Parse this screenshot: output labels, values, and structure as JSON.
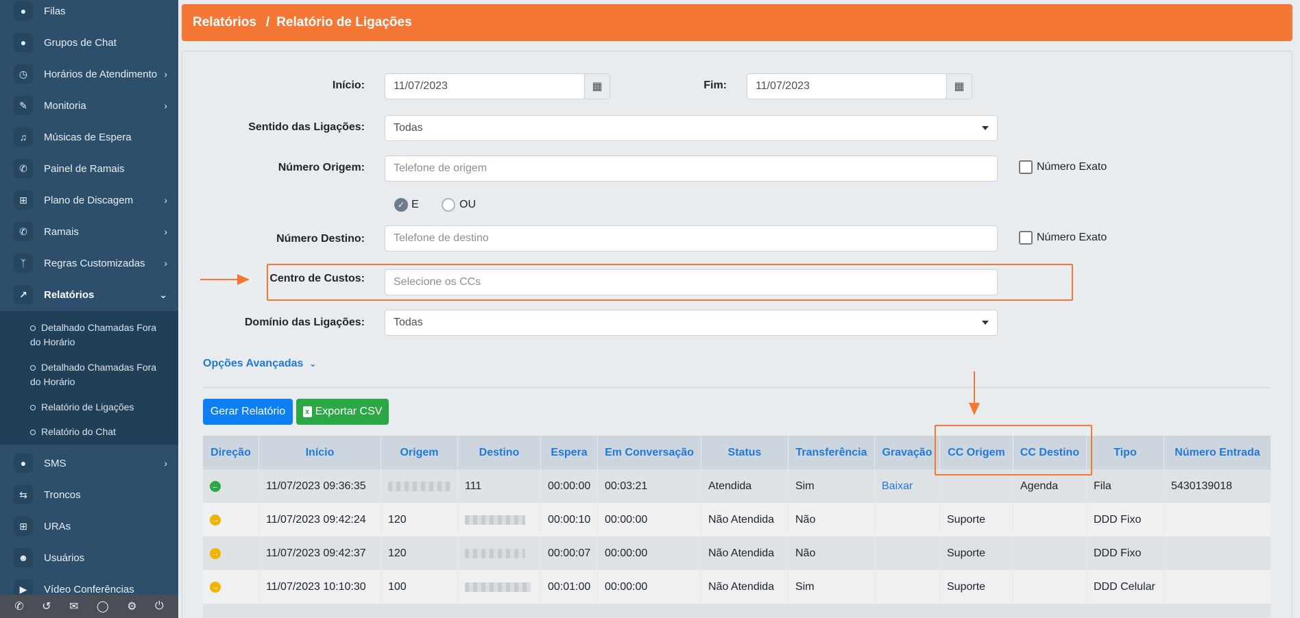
{
  "sidebar": {
    "items": [
      {
        "label": "Filas",
        "icon": "users-icon",
        "chevron": false
      },
      {
        "label": "Grupos de Chat",
        "icon": "users-icon",
        "chevron": false
      },
      {
        "label": "Horários de Atendimento",
        "icon": "clock-icon",
        "chevron": true
      },
      {
        "label": "Monitoria",
        "icon": "edit-icon",
        "chevron": true
      },
      {
        "label": "Músicas de Espera",
        "icon": "music-icon",
        "chevron": false
      },
      {
        "label": "Painel de Ramais",
        "icon": "phone-icon",
        "chevron": false
      },
      {
        "label": "Plano de Discagem",
        "icon": "sitemap-icon",
        "chevron": true
      },
      {
        "label": "Ramais",
        "icon": "phone-icon",
        "chevron": true
      },
      {
        "label": "Regras Customizadas",
        "icon": "branch-icon",
        "chevron": true
      },
      {
        "label": "Relatórios",
        "icon": "chart-icon",
        "chevron": "down"
      },
      {
        "label": "SMS",
        "icon": "comment-icon",
        "chevron": true
      },
      {
        "label": "Troncos",
        "icon": "exchange-icon",
        "chevron": false
      },
      {
        "label": "URAs",
        "icon": "sitemap-icon",
        "chevron": false
      },
      {
        "label": "Usuários",
        "icon": "user-icon",
        "chevron": false
      },
      {
        "label": "Vídeo Conferências",
        "icon": "video-icon",
        "chevron": false
      }
    ],
    "submenu": [
      "Detalhado Chamadas Fora do Horário",
      "Detalhado Chamadas Fora do Horário",
      "Relatório de Ligações",
      "Relatório do Chat"
    ]
  },
  "header": {
    "section": "Relatórios",
    "separator": "/",
    "page": "Relatório de Ligações"
  },
  "form": {
    "inicio_label": "Início:",
    "inicio_value": "11/07/2023",
    "fim_label": "Fim:",
    "fim_value": "11/07/2023",
    "sentido_label": "Sentido das Ligações:",
    "sentido_value": "Todas",
    "origem_label": "Número Origem:",
    "origem_placeholder": "Telefone de origem",
    "exato_label": "Número Exato",
    "radio_e": "E",
    "radio_ou": "OU",
    "destino_label": "Número Destino:",
    "destino_placeholder": "Telefone de destino",
    "cc_label": "Centro de Custos:",
    "cc_placeholder": "Selecione os CCs",
    "dominio_label": "Domínio das Ligações:",
    "dominio_value": "Todas",
    "advanced_label": "Opções Avançadas",
    "gerar_label": "Gerar Relatório",
    "export_label": "Exportar CSV"
  },
  "table": {
    "headers": [
      "Direção",
      "Início",
      "Origem",
      "Destino",
      "Espera",
      "Em Conversação",
      "Status",
      "Transferência",
      "Gravação",
      "CC Origem",
      "CC Destino",
      "Tipo",
      "Número Entrada"
    ],
    "rows": [
      {
        "direction": "incoming",
        "inicio": "11/07/2023 09:36:35",
        "origem": "",
        "destino": "111",
        "espera": "00:00:00",
        "conversa": "00:03:21",
        "status": "Atendida",
        "transf": "Sim",
        "gravacao": "Baixar",
        "cc_origem": "",
        "cc_destino": "Agenda",
        "tipo": "Fila",
        "entrada": "5430139018"
      },
      {
        "direction": "outgoing",
        "inicio": "11/07/2023 09:42:24",
        "origem": "120",
        "destino": "",
        "espera": "00:00:10",
        "conversa": "00:00:00",
        "status": "Não Atendida",
        "transf": "Não",
        "gravacao": "",
        "cc_origem": "Suporte",
        "cc_destino": "",
        "tipo": "DDD Fixo",
        "entrada": ""
      },
      {
        "direction": "outgoing",
        "inicio": "11/07/2023 09:42:37",
        "origem": "120",
        "destino": "",
        "espera": "00:00:07",
        "conversa": "00:00:00",
        "status": "Não Atendida",
        "transf": "Não",
        "gravacao": "",
        "cc_origem": "Suporte",
        "cc_destino": "",
        "tipo": "DDD Fixo",
        "entrada": ""
      },
      {
        "direction": "outgoing",
        "inicio": "11/07/2023 10:10:30",
        "origem": "100",
        "destino": "",
        "espera": "00:01:00",
        "conversa": "00:00:00",
        "status": "Não Atendida",
        "transf": "Sim",
        "gravacao": "",
        "cc_origem": "Suporte",
        "cc_destino": "",
        "tipo": "DDD Celular",
        "entrada": ""
      }
    ]
  },
  "colors": {
    "accent": "#f47735",
    "link": "#1e7ad6",
    "sidebar": "#2d4f6c",
    "incoming": "#2ca745",
    "outgoing": "#f0b400"
  }
}
